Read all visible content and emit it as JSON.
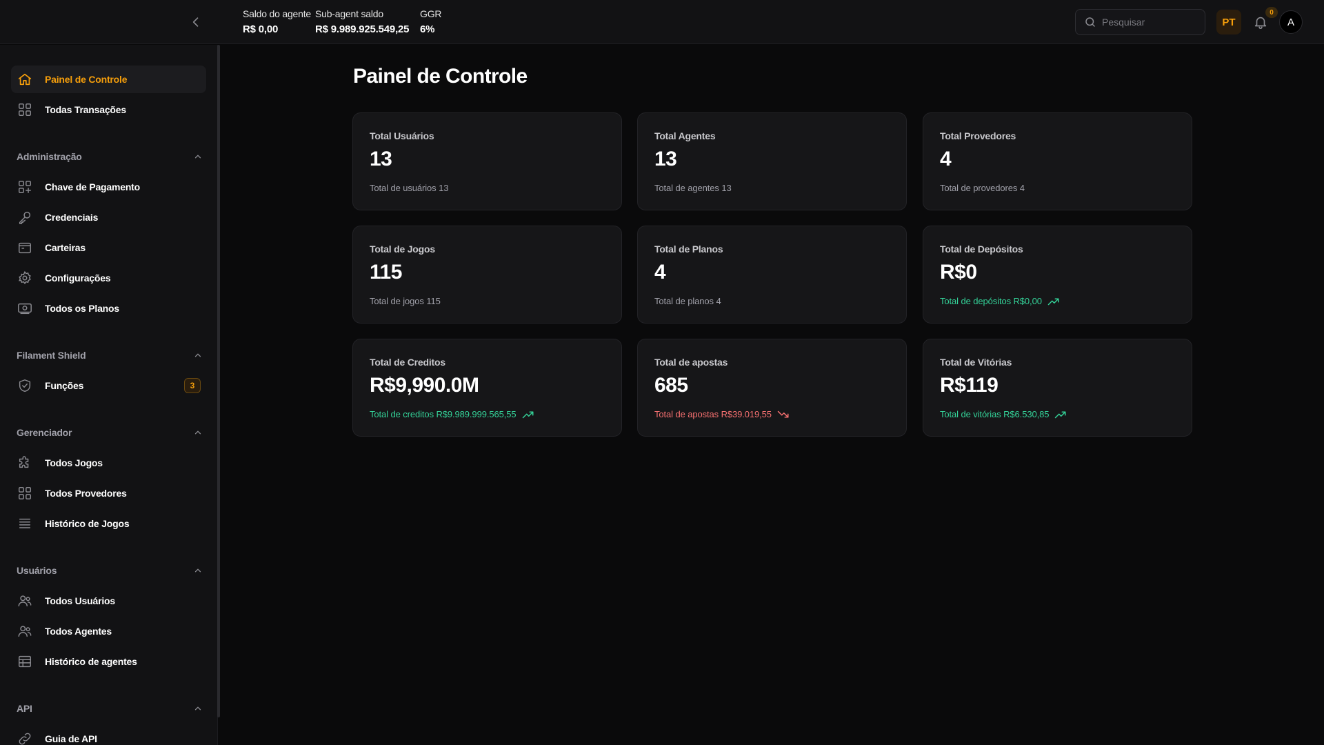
{
  "topbar": {
    "stats": [
      {
        "label": "Saldo do agente",
        "value": "R$ 0,00"
      },
      {
        "label": "Sub-agent saldo",
        "value": "R$ 9.989.925.549,25"
      },
      {
        "label": "GGR",
        "value": "6%"
      }
    ],
    "search_placeholder": "Pesquisar",
    "language": "PT",
    "notification_count": "0",
    "avatar_initial": "A"
  },
  "sidebar": {
    "top_items": [
      {
        "label": "Painel de Controle",
        "icon": "home-icon",
        "active": true
      },
      {
        "label": "Todas Transações",
        "icon": "grid-icon"
      }
    ],
    "groups": [
      {
        "title": "Administração",
        "items": [
          {
            "label": "Chave de Pagamento",
            "icon": "grid-plus-icon"
          },
          {
            "label": "Credenciais",
            "icon": "key-icon"
          },
          {
            "label": "Carteiras",
            "icon": "wallet-icon"
          },
          {
            "label": "Configurações",
            "icon": "gear-icon"
          },
          {
            "label": "Todos os Planos",
            "icon": "banknote-icon"
          }
        ]
      },
      {
        "title": "Filament Shield",
        "items": [
          {
            "label": "Funções",
            "icon": "shield-check-icon",
            "badge": "3"
          }
        ]
      },
      {
        "title": "Gerenciador",
        "items": [
          {
            "label": "Todos Jogos",
            "icon": "puzzle-icon"
          },
          {
            "label": "Todos Provedores",
            "icon": "grid-icon"
          },
          {
            "label": "Histórico de Jogos",
            "icon": "list-icon"
          }
        ]
      },
      {
        "title": "Usuários",
        "items": [
          {
            "label": "Todos Usuários",
            "icon": "users-icon"
          },
          {
            "label": "Todos Agentes",
            "icon": "users-icon"
          },
          {
            "label": "Histórico de agentes",
            "icon": "table-icon"
          }
        ]
      },
      {
        "title": "API",
        "items": [
          {
            "label": "Guia de API",
            "icon": "link-icon"
          }
        ]
      }
    ]
  },
  "main": {
    "title": "Painel de Controle",
    "cards": [
      {
        "label": "Total Usuários",
        "value": "13",
        "desc": "Total de usuários 13",
        "trend": "none"
      },
      {
        "label": "Total Agentes",
        "value": "13",
        "desc": "Total de agentes 13",
        "trend": "none"
      },
      {
        "label": "Total Provedores",
        "value": "4",
        "desc": "Total de provedores 4",
        "trend": "none"
      },
      {
        "label": "Total de Jogos",
        "value": "115",
        "desc": "Total de jogos 115",
        "trend": "none"
      },
      {
        "label": "Total de Planos",
        "value": "4",
        "desc": "Total de planos 4",
        "trend": "none"
      },
      {
        "label": "Total de Depósitos",
        "value": "R$0",
        "desc": "Total de depósitos R$0,00",
        "trend": "up"
      },
      {
        "label": "Total de Creditos",
        "value": "R$9,990.0M",
        "desc": "Total de creditos R$9.989.999.565,55",
        "trend": "up"
      },
      {
        "label": "Total de apostas",
        "value": "685",
        "desc": "Total de apostas R$39.019,55",
        "trend": "down"
      },
      {
        "label": "Total de Vitórias",
        "value": "R$119",
        "desc": "Total de vitórias R$6.530,85",
        "trend": "up"
      }
    ]
  },
  "colors": {
    "accent": "#f59e0b",
    "positive": "#34d399",
    "negative": "#f87171",
    "background": "#0a0a0b",
    "surface": "#161618"
  }
}
